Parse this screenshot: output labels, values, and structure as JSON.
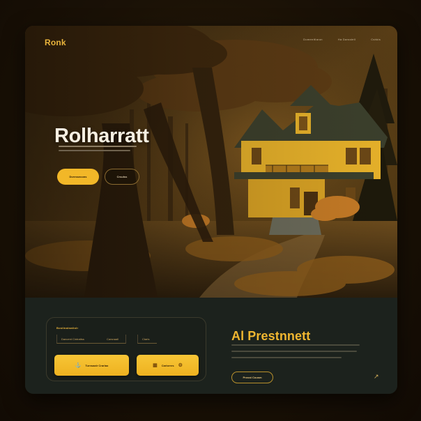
{
  "brand": {
    "name": "Ronk"
  },
  "nav": {
    "items": [
      "Domenttlaron",
      "Ha Darsstell",
      "Cshkis"
    ]
  },
  "hero": {
    "title": "Rolharratt",
    "primary_button": "Dverssecons",
    "secondary_button": "Crsulss"
  },
  "booking": {
    "title": "Bostlnatnatiolr",
    "field1_text": "Dancent Cintrattss",
    "field2_text": "Carsnaall",
    "side_field_text": "Ctaris",
    "action1_label": "Turnsaalr Crarlao",
    "action2_label": "Carlorres"
  },
  "section": {
    "title": "Al Prestnnett",
    "cta_label": "Prosst Cousm",
    "next_icon": "arrow-icon"
  },
  "colors": {
    "accent": "#f2b728",
    "dark_bg": "#1c221d",
    "title_text": "#f6efe2"
  }
}
